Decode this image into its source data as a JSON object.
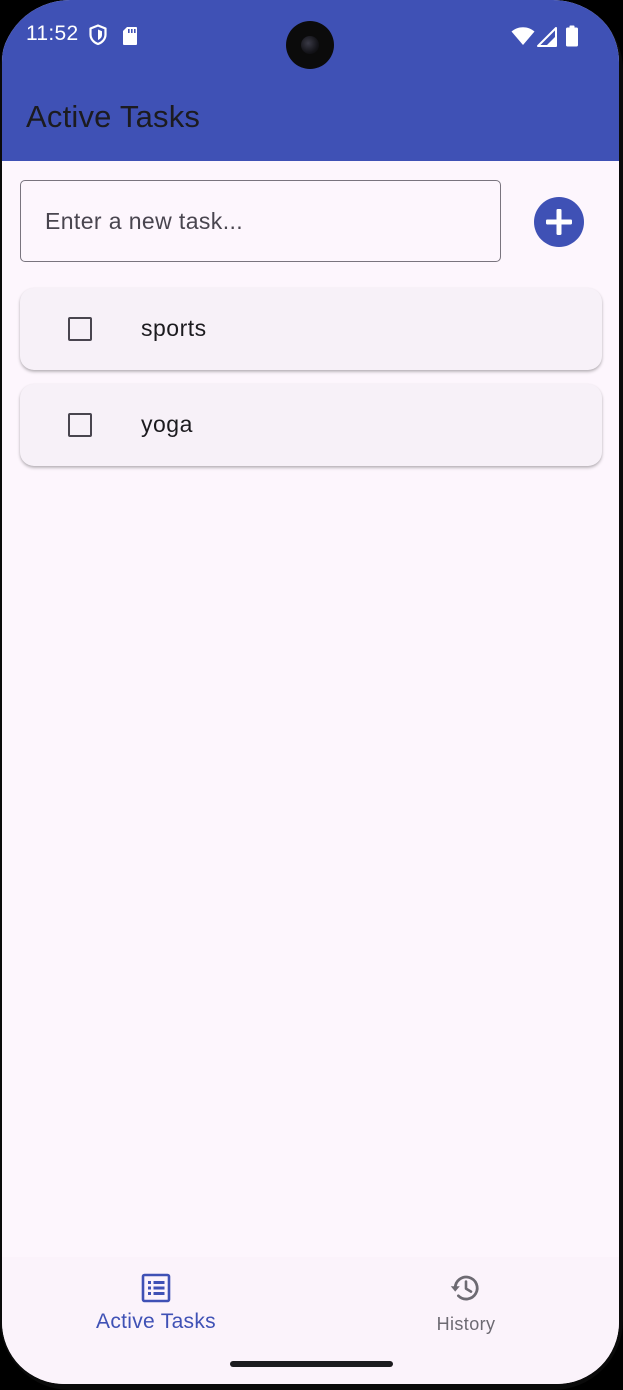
{
  "status_bar": {
    "time": "11:52",
    "left_icons": [
      "shield-icon",
      "sd-card-icon"
    ],
    "right_icons": [
      "wifi-icon",
      "cell-signal-icon",
      "battery-icon"
    ]
  },
  "app_bar": {
    "title": "Active Tasks",
    "color": "#3f51b5"
  },
  "new_task": {
    "value": "",
    "placeholder": "Enter a new task...",
    "add_icon": "plus-circle-icon"
  },
  "tasks": [
    {
      "label": "sports",
      "checked": false
    },
    {
      "label": "yoga",
      "checked": false
    }
  ],
  "bottom_nav": {
    "items": [
      {
        "label": "Active Tasks",
        "icon": "list-icon",
        "active": true
      },
      {
        "label": "History",
        "icon": "history-icon",
        "active": false
      }
    ]
  },
  "colors": {
    "accent": "#3f51b5",
    "background": "#fdf6fd",
    "card": "#f7f1f8"
  }
}
